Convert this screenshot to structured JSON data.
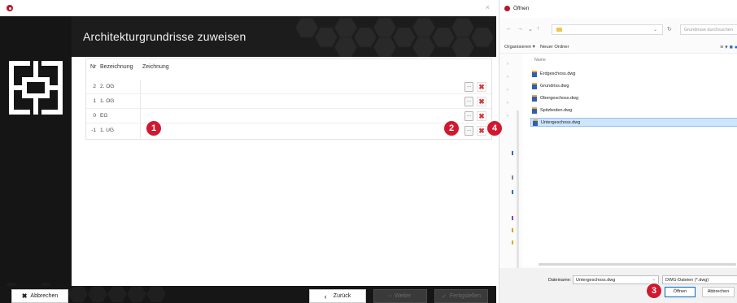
{
  "main_window": {
    "title": "Architekturgrundrisse zuweisen",
    "close_glyph": "×"
  },
  "table": {
    "headers": {
      "nr": "Nr",
      "bezeichnung": "Bezeichnung",
      "zeichnung": "Zeichnung"
    },
    "rows": [
      {
        "nr": "2",
        "bezeichnung": "2. OG",
        "zeichnung": ""
      },
      {
        "nr": "1",
        "bezeichnung": "1. OG",
        "zeichnung": ""
      },
      {
        "nr": "0",
        "bezeichnung": "EG",
        "zeichnung": ""
      },
      {
        "nr": "-1",
        "bezeichnung": "1. UG",
        "zeichnung": ""
      }
    ],
    "browse_label": "...",
    "delete_glyph": "✖"
  },
  "badges": [
    "1",
    "2",
    "3",
    "4"
  ],
  "footer": {
    "cancel_label": "Abbrechen",
    "back_label": "Zurück",
    "next_label": "Weiter",
    "finish_label": "Fertigstellen"
  },
  "dialog": {
    "title": "Öffnen",
    "address_chevron": "⌄",
    "search_placeholder": "Grundrisse durchsuchen",
    "organize_label": "Organisieren ▾",
    "new_folder_label": "Neuer Ordner",
    "column_name": "Name",
    "files": [
      {
        "name": "Erdgeschoss.dwg",
        "selected": false
      },
      {
        "name": "Grundriss.dwg",
        "selected": false
      },
      {
        "name": "Obergeschoss.dwg",
        "selected": false
      },
      {
        "name": "Spitzboden.dwg",
        "selected": false
      },
      {
        "name": "Untergeschoss.dwg",
        "selected": true
      }
    ],
    "filename_label": "Dateiname:",
    "filename_value": "Untergeschoss.dwg",
    "filetype_value": "DWG-Dateien (*.dwg)",
    "open_label": "Öffnen",
    "cancel_label": "Abbrechen"
  },
  "colors": {
    "accent_red": "#d0182f",
    "dark_bg": "#151515",
    "selection": "#cfe5fb"
  }
}
